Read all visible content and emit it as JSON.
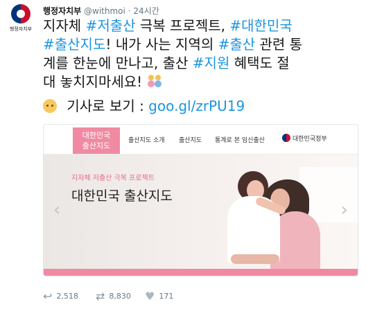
{
  "tweet": {
    "author": {
      "name": "행정자치부",
      "handle": "@withmoi",
      "time": "24시간",
      "avatar_text": "행정자치부"
    },
    "text_lines": [
      [
        "지자체 ",
        "#저출산",
        " 극복 프로젝트, ",
        "#대한민국"
      ],
      [
        "#출산지도",
        "! 내가 사는 지역의 ",
        "#출산",
        " 관련 통"
      ],
      [
        "계를 한눈에 만나고, 출산 ",
        "#지원",
        " 혜택도 절"
      ],
      [
        "대 놓치지마세요! "
      ]
    ],
    "link_line": {
      "prefix": " 기사로 보기 : ",
      "url": "goo.gl/zrPU19"
    }
  },
  "card": {
    "nav": {
      "logo_line1": "대한민국",
      "logo_line2": "출산지도",
      "items": [
        "출산지도 소개",
        "출산지도",
        "통계로 본 임신출산"
      ],
      "gov_label": "대한민국정부"
    },
    "hero": {
      "subtitle": "지자체 저출산 극복 프로젝트",
      "title": "대한민국 출산지도"
    }
  },
  "actions": {
    "reply_count": "2,518",
    "retweet_count": "8,830",
    "like_count": "171"
  },
  "icons": [
    "reply-icon",
    "retweet-icon",
    "like-icon",
    "family-emoji-icon",
    "baby-emoji-icon"
  ],
  "colors": {
    "hashtag": "#1b95e0",
    "pink_accent": "#f08aa2",
    "muted": "#657786"
  }
}
